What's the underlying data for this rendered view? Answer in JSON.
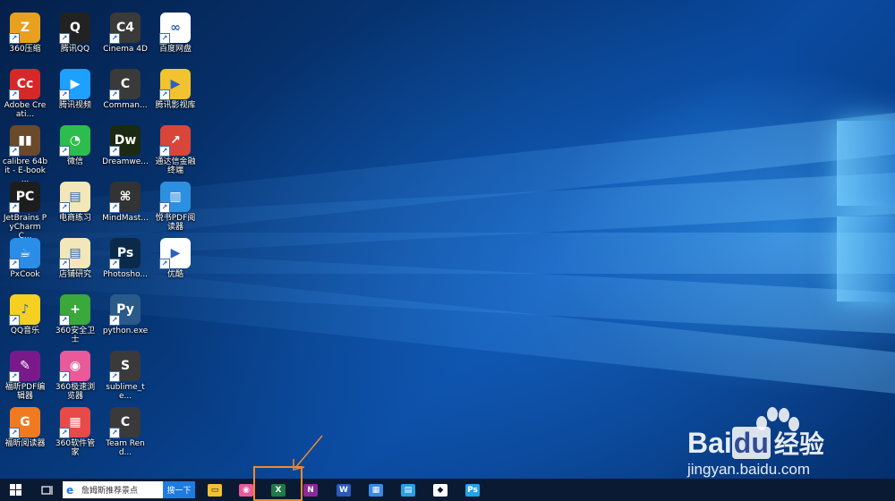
{
  "desktop": {
    "icons": [
      {
        "label": "360压缩",
        "color": "#e8a020",
        "glyph": "Z"
      },
      {
        "label": "腾讯QQ",
        "color": "#222222",
        "glyph": "Q"
      },
      {
        "label": "Cinema 4D",
        "color": "#3a3a3a",
        "glyph": "C4"
      },
      {
        "label": "百度网盘",
        "color": "#ffffff",
        "glyph": "∞"
      },
      {
        "label": "Adobe Creati...",
        "color": "#d62828",
        "glyph": "Cc"
      },
      {
        "label": "腾讯视频",
        "color": "#1ea0ff",
        "glyph": "▶"
      },
      {
        "label": "Comman...",
        "color": "#3a3a3a",
        "glyph": "C"
      },
      {
        "label": "腾讯影视库",
        "color": "#f2c230",
        "glyph": "▶"
      },
      {
        "label": "calibre 64bit - E-book ...",
        "color": "#6a4a2a",
        "glyph": "▮▮"
      },
      {
        "label": "微信",
        "color": "#2dbd4e",
        "glyph": "◔"
      },
      {
        "label": "Dreamwe...",
        "color": "#1b2a10",
        "glyph": "Dw"
      },
      {
        "label": "通达信金融终端",
        "color": "#d8463a",
        "glyph": "↗"
      },
      {
        "label": "JetBrains PyCharm C...",
        "color": "#1d1d1d",
        "glyph": "PC"
      },
      {
        "label": "电商练习",
        "color": "#f3e6b8",
        "glyph": "▤"
      },
      {
        "label": "MindMast...",
        "color": "#333333",
        "glyph": "⌘"
      },
      {
        "label": "悦书PDF阅读器",
        "color": "#2d8fe0",
        "glyph": "▥"
      },
      {
        "label": "PxCook",
        "color": "#2a8de8",
        "glyph": "☕"
      },
      {
        "label": "店铺研究",
        "color": "#f3e6b8",
        "glyph": "▤"
      },
      {
        "label": "Photosho...",
        "color": "#0b2a4a",
        "glyph": "Ps"
      },
      {
        "label": "优酷",
        "color": "#ffffff",
        "glyph": "▶"
      },
      {
        "label": "QQ音乐",
        "color": "#f5d020",
        "glyph": "♪"
      },
      {
        "label": "360安全卫士",
        "color": "#3aa83a",
        "glyph": "+"
      },
      {
        "label": "python.exe",
        "color": "#2a5a8a",
        "glyph": "Py"
      },
      {
        "label": "",
        "color": "",
        "glyph": ""
      },
      {
        "label": "福昕PDF编辑器",
        "color": "#7a1a8a",
        "glyph": "✎"
      },
      {
        "label": "360极速浏览器",
        "color": "#e85a9a",
        "glyph": "◉"
      },
      {
        "label": "sublime_te...",
        "color": "#3a3a3a",
        "glyph": "S"
      },
      {
        "label": "",
        "color": "",
        "glyph": ""
      },
      {
        "label": "福昕阅读器",
        "color": "#f07a20",
        "glyph": "G"
      },
      {
        "label": "360软件管家",
        "color": "#e84a4a",
        "glyph": "▦"
      },
      {
        "label": "Team Rend...",
        "color": "#3a3a3a",
        "glyph": "C"
      }
    ]
  },
  "taskbar": {
    "search_text": "詹姆斯推荐景点",
    "search_button": "搜一下",
    "apps": [
      {
        "name": "file-explorer",
        "glyph": "▭",
        "color": "#f2c230"
      },
      {
        "name": "browser-360",
        "glyph": "◉",
        "color": "#e85a9a"
      },
      {
        "name": "excel",
        "glyph": "X",
        "color": "#1f7a45"
      },
      {
        "name": "onenote",
        "glyph": "N",
        "color": "#8a2a9a"
      },
      {
        "name": "word",
        "glyph": "W",
        "color": "#2a5ab8"
      },
      {
        "name": "store",
        "glyph": "▦",
        "color": "#3a8ae0"
      },
      {
        "name": "app-blue",
        "glyph": "▤",
        "color": "#2aa0e0"
      },
      {
        "name": "app-white",
        "glyph": "◆",
        "color": "#ffffff"
      },
      {
        "name": "photoshop",
        "glyph": "Ps",
        "color": "#2aa0e8"
      }
    ]
  },
  "watermark": {
    "brand": "Bai",
    "brand2": "du",
    "cn": "经验",
    "url": "jingyan.baidu.com"
  }
}
